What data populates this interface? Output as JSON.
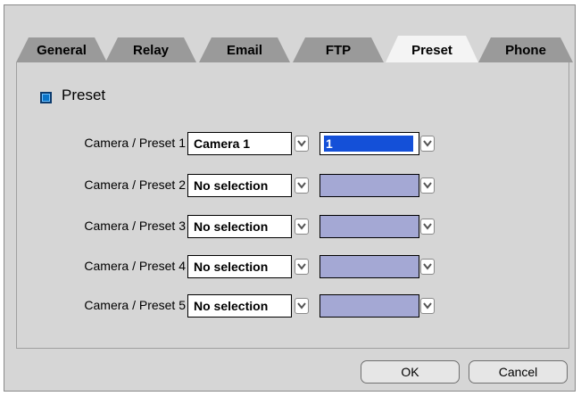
{
  "tabs": [
    {
      "label": "General"
    },
    {
      "label": "Relay"
    },
    {
      "label": "Email"
    },
    {
      "label": "FTP"
    },
    {
      "label": "Preset",
      "active": true
    },
    {
      "label": "Phone"
    }
  ],
  "section": {
    "title": "Preset",
    "icon": "blue-square-icon"
  },
  "rows": [
    {
      "label": "Camera / Preset 1",
      "camera": "Camera 1",
      "preset": "1"
    },
    {
      "label": "Camera / Preset 2",
      "camera": "No selection",
      "preset": ""
    },
    {
      "label": "Camera / Preset 3",
      "camera": "No selection",
      "preset": ""
    },
    {
      "label": "Camera / Preset 4",
      "camera": "No selection",
      "preset": ""
    },
    {
      "label": "Camera / Preset 5",
      "camera": "No selection",
      "preset": ""
    }
  ],
  "buttons": {
    "ok": "OK",
    "cancel": "Cancel"
  },
  "colors": {
    "panel": "#d6d6d6",
    "inactive_tab": "#9a9a9a",
    "active_tab": "#f4f4f4",
    "preset_disabled": "#a4a8d4",
    "selection": "#1450d8"
  }
}
